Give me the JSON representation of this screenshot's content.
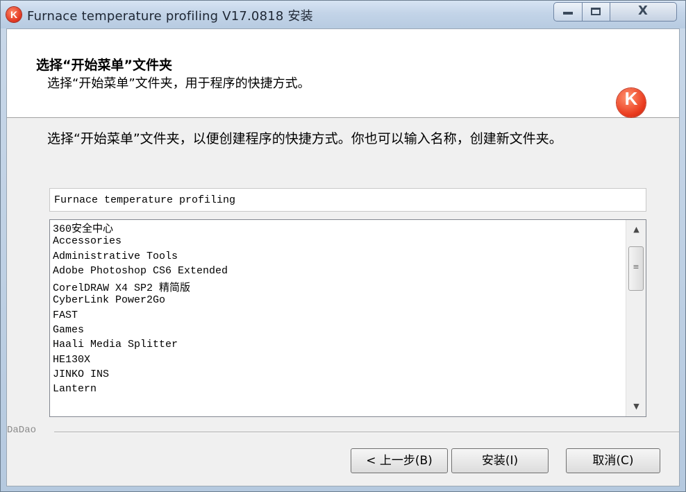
{
  "window": {
    "title": "Furnace temperature profiling V17.0818 安装",
    "app_icon_letter": "K",
    "close_glyph": "X"
  },
  "header": {
    "title": "选择“开始菜单”文件夹",
    "subtitle": "选择“开始菜单”文件夹，用于程序的快捷方式。",
    "logo_letter": "K"
  },
  "body": {
    "description": "选择“开始菜单”文件夹，以便创建程序的快捷方式。你也可以输入名称，创建新文件夹。",
    "folder_input_value": "Furnace temperature profiling",
    "folders": [
      "360安全中心",
      "Accessories",
      "Administrative Tools",
      "Adobe Photoshop CS6 Extended",
      "CorelDRAW X4 SP2 精简版",
      "CyberLink Power2Go",
      "FAST",
      "Games",
      "Haali Media Splitter",
      "HE130X",
      "JINKO INS",
      "Lantern"
    ]
  },
  "footer": {
    "brand": "DaDao",
    "back_label": "< 上一步(B)",
    "install_label": "安装(I)",
    "cancel_label": "取消(C)"
  },
  "colors": {
    "accent_red": "#e0321c",
    "titlebar_blue": "#c3d4e8"
  }
}
